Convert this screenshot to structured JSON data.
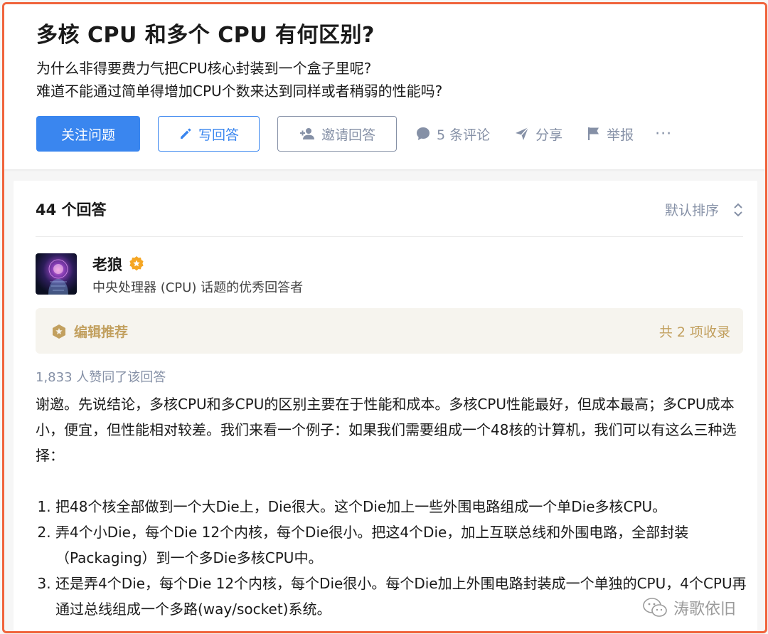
{
  "question": {
    "title": "多核 CPU 和多个 CPU 有何区别?",
    "description": [
      "为什么非得要费力气把CPU核心封装到一个盒子里呢?",
      "难道不能通过简单得增加CPU个数来达到同样或者稍弱的性能吗?"
    ]
  },
  "actions": {
    "follow": "关注问题",
    "write_answer": "写回答",
    "invite": "邀请回答",
    "comments": "5 条评论",
    "share": "分享",
    "report": "举报",
    "more": "···"
  },
  "icons": {
    "write": "pencil-icon",
    "invite": "add-person-icon",
    "comments": "comment-bubble-icon",
    "share": "paper-plane-icon",
    "report": "flag-icon",
    "sort": "sort-updown-icon",
    "badge": "gold-badge-icon",
    "recommend": "hexagon-star-icon",
    "watermark": "wechat-icon"
  },
  "answers_header": {
    "count": "44 个回答",
    "sort": "默认排序"
  },
  "answer": {
    "author_name": "老狼",
    "author_bio": "中央处理器 (CPU) 话题的优秀回答者",
    "editor_label": "编辑推荐",
    "collections": "共 2 项收录",
    "votes": "1,833 人赞同了该回答",
    "paragraph": "谢邀。先说结论，多核CPU和多CPU的区别主要在于性能和成本。多核CPU性能最好，但成本最高；多CPU成本小，便宜，但性能相对较差。我们来看一个例子：如果我们需要组成一个48核的计算机，我们可以有这么三种选择：",
    "list": [
      "把48个核全部做到一个大Die上，Die很大。这个Die加上一些外围电路组成一个单Die多核CPU。",
      "弄4个小Die，每个Die 12个内核，每个Die很小。把这4个Die，加上互联总线和外围电路，全部封装（Packaging）到一个多Die多核CPU中。",
      "还是弄4个Die，每个Die 12个内核，每个Die很小。每个Die加上外围电路封装成一个单独的CPU，4个CPU再通过总线组成一个多路(way/socket)系统。"
    ]
  },
  "watermark": "涛歌依旧",
  "colors": {
    "primary": "#3a86ef",
    "muted": "#8590a6",
    "gold": "#c2a05f",
    "frame": "#f0643c"
  }
}
